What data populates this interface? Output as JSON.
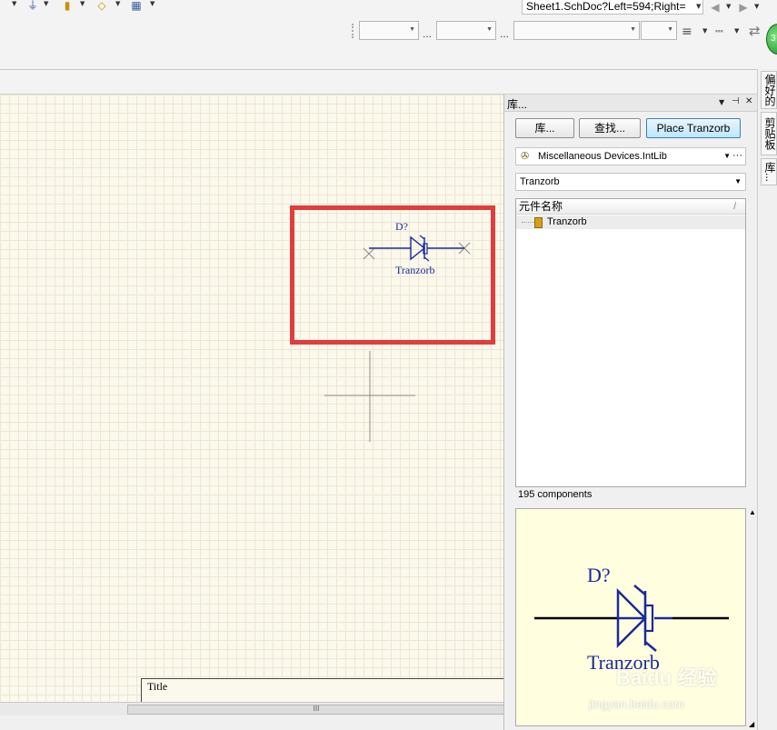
{
  "toolbar": {
    "address_text": "Sheet1.SchDoc?Left=594;Right=",
    "ellipsis": "...",
    "icons": [
      "ground-icon",
      "probe-icon",
      "port-icon",
      "grid-icon"
    ]
  },
  "canvas": {
    "component_designator": "D?",
    "component_name": "Tranzorb",
    "title_block_label": "Title",
    "scroll_thumb_grip": "III",
    "highlight_color": "#e23c3c"
  },
  "library_panel": {
    "title": "库...",
    "buttons": {
      "libraries": "库...",
      "search": "查找...",
      "place": "Place Tranzorb"
    },
    "library_selected": "Miscellaneous Devices.IntLib",
    "filter_value": "Tranzorb",
    "column_header": "元件名称",
    "rows": [
      "Tranzorb"
    ],
    "count_text": "195 components",
    "preview": {
      "designator": "D?",
      "name": "Tranzorb"
    }
  },
  "side_tabs": [
    "偏好的",
    "剪贴板",
    "库..."
  ],
  "watermark": {
    "brand": "Baidu 经验",
    "url": "jingyan.baidu.com"
  }
}
